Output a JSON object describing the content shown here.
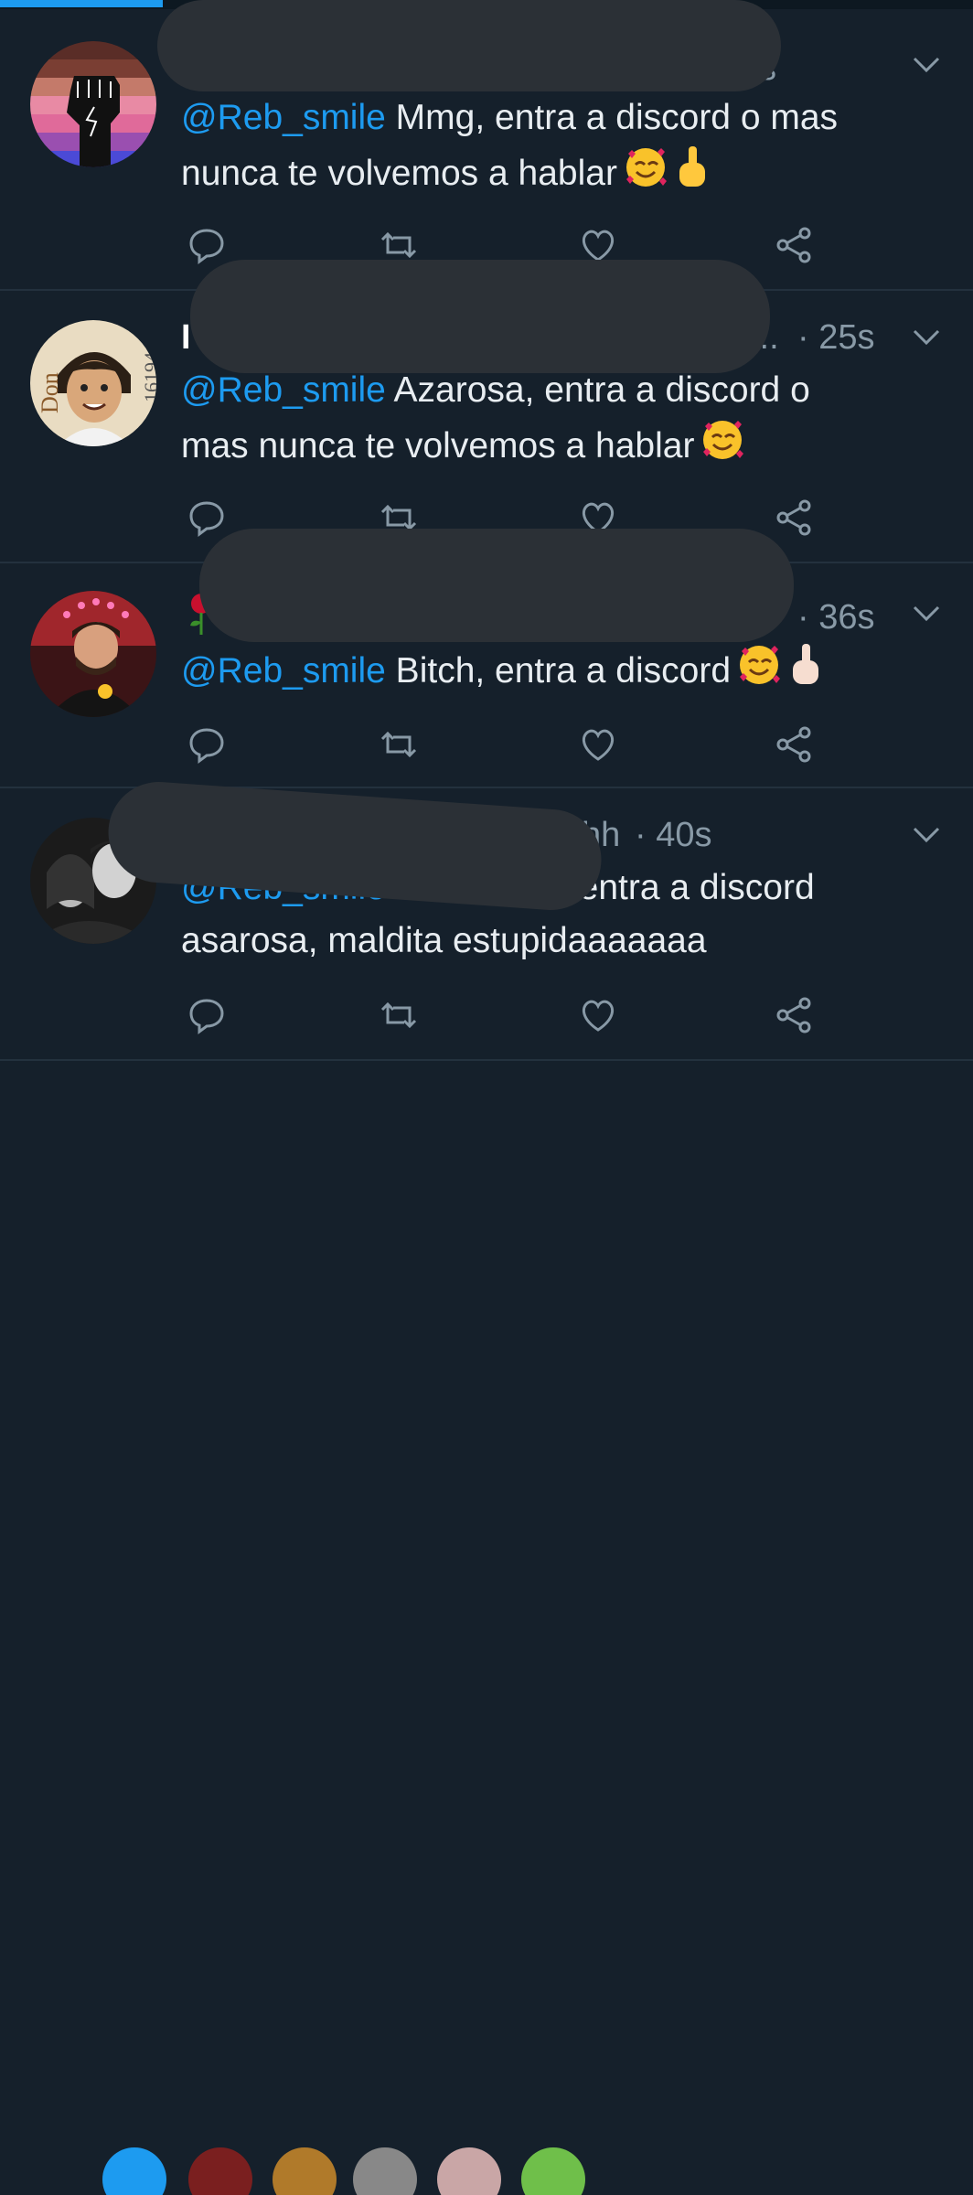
{
  "tweets": [
    {
      "time": "s",
      "reply_to": "@Reb_smile",
      "text_line1": " Mmg, entra a discord o mas",
      "text_line2": "nunca te volvemos a hablar",
      "emojis": [
        "smiling-face-with-hearts-emoji",
        "middle-finger-emoji"
      ]
    },
    {
      "name_fragment": "I",
      "ellipsis": "...",
      "time": "· 25s",
      "reply_to": "@Reb_smile",
      "text_line1": " Azarosa, entra a discord o",
      "text_line2": "mas nunca te volvemos a hablar",
      "emojis": [
        "smiling-face-with-hearts-emoji"
      ]
    },
    {
      "time": "· 36s",
      "reply_to": "@Reb_smile",
      "text_line1": " Bitch, entra a discord",
      "emojis": [
        "rose-emoji",
        "smiling-face-with-hearts-emoji",
        "middle-finger-emoji"
      ]
    },
    {
      "name_fragment_end": "hh",
      "time": "· 40s",
      "reply_to": "@Reb_smile",
      "text_line1": " entra a discord",
      "text_line2": "asarosa, maldita estupidaaaaaaa",
      "emojis": []
    }
  ],
  "icons": {
    "reply": "reply-icon",
    "retweet": "retweet-icon",
    "like": "like-icon",
    "share": "share-icon",
    "caret": "chevron-down-icon"
  },
  "colors": {
    "background": "#15202b",
    "mention": "#1d9bf0",
    "muted": "#8899a6",
    "divider": "#23313e",
    "redaction": "#2b3036"
  }
}
